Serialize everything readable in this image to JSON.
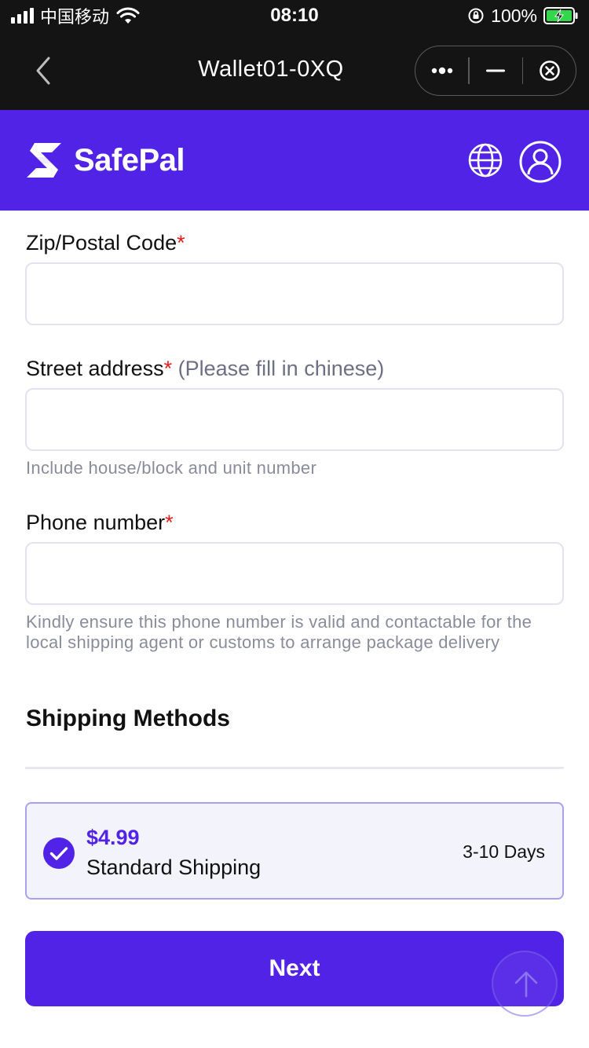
{
  "status_bar": {
    "carrier": "中国移动",
    "time": "08:10",
    "battery_percent": "100%"
  },
  "nav": {
    "title": "Wallet01-0XQ"
  },
  "brand": {
    "name": "SafePal",
    "color": "#5023e6"
  },
  "form": {
    "zip": {
      "label": "Zip/Postal Code",
      "required_mark": "*",
      "value": ""
    },
    "street": {
      "label": "Street address",
      "required_mark": "*",
      "label_hint": "(Please fill in chinese)",
      "value": "",
      "helper": "Include house/block and unit number"
    },
    "phone": {
      "label": "Phone number",
      "required_mark": "*",
      "value": "",
      "helper": "Kindly ensure this phone number is valid and contactable for the local shipping agent or customs to arrange package delivery"
    }
  },
  "shipping": {
    "title": "Shipping Methods",
    "options": [
      {
        "price": "$4.99",
        "name": "Standard Shipping",
        "duration": "3-10 Days",
        "selected": true
      }
    ]
  },
  "actions": {
    "next_label": "Next"
  },
  "icons": {
    "back": "chevron-left-icon",
    "more": "more-dots-icon",
    "minimize": "minus-icon",
    "close": "close-circle-icon",
    "language": "globe-icon",
    "account": "user-icon",
    "selected": "check-circle-icon",
    "scroll_top": "arrow-up-icon"
  },
  "colors": {
    "accent": "#5023e6",
    "required": "#e21b1b",
    "card_bg": "#f3f3fc",
    "card_border": "#a9a0f0"
  }
}
